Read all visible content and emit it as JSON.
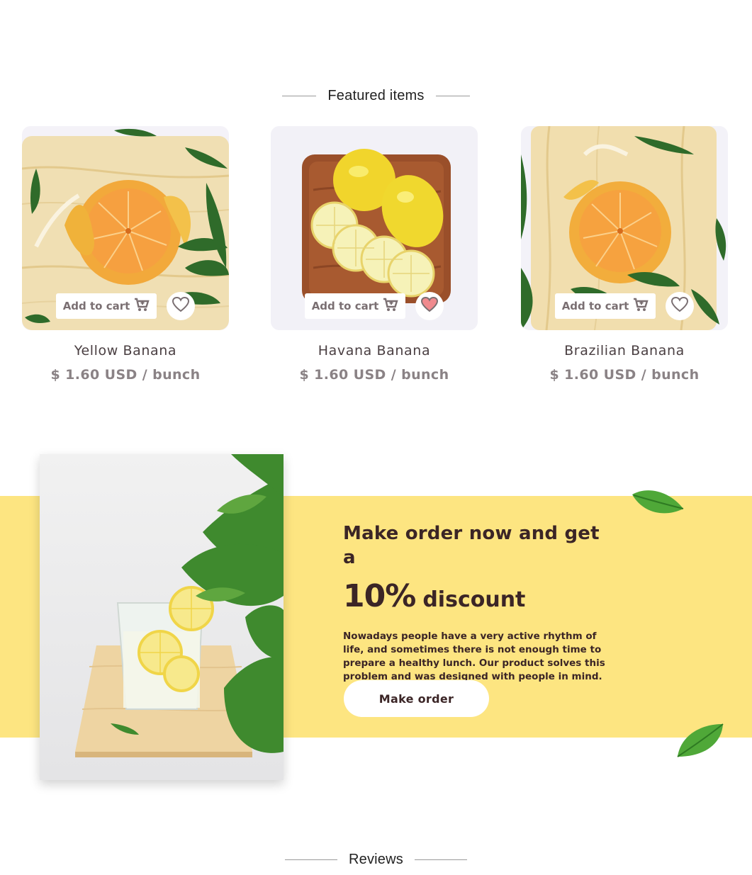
{
  "featured": {
    "heading": "Featured items",
    "products": [
      {
        "name": "Yellow Banana",
        "price": "$ 1.60 USD / bunch",
        "add_label": "Add to cart",
        "favorited": false
      },
      {
        "name": "Havana Banana",
        "price": "$ 1.60 USD / bunch",
        "add_label": "Add to cart",
        "favorited": true
      },
      {
        "name": "Brazilian Banana",
        "price": "$ 1.60 USD / bunch",
        "add_label": "Add to cart",
        "favorited": false
      }
    ]
  },
  "promo": {
    "headline": "Make order now and get a",
    "discount_value": "10%",
    "discount_word": "discount",
    "description": "Nowadays people have a very active rhythm of life, and sometimes there is not enough time to prepare a healthy lunch. Our product solves this problem and was designed with people in mind.",
    "button_label": "Make order"
  },
  "reviews": {
    "heading": "Reviews"
  },
  "colors": {
    "promo_band": "#fde581",
    "heart_active": "#f08a8e",
    "text_dark": "#3b2526",
    "price_gray": "#8a8285"
  },
  "icons": [
    "cart-icon",
    "heart-icon",
    "leaf-icon"
  ]
}
